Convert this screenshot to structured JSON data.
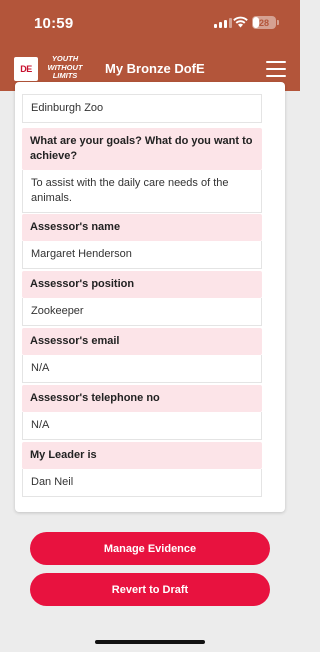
{
  "status_bar": {
    "time": "10:59",
    "battery_percent": "28",
    "battery_level": 0.28
  },
  "header": {
    "logo_text": "DE",
    "slogan": "Youth Without Limits",
    "title": "My Bronze DofE",
    "menu_icon": "hamburger-icon",
    "background_color": "#b3553a"
  },
  "details": {
    "location_value": "Edinburgh Zoo",
    "goals_label": "What are your goals? What do you want to achieve?",
    "goals_value": "To assist with the daily care needs of the animals.",
    "assessor_name_label": "Assessor's name",
    "assessor_name_value": "Margaret Henderson",
    "assessor_position_label": "Assessor's position",
    "assessor_position_value": "Zookeeper",
    "assessor_email_label": "Assessor's email",
    "assessor_email_value": "N/A",
    "assessor_phone_label": "Assessor's telephone no",
    "assessor_phone_value": "N/A",
    "leader_label": "My Leader is",
    "leader_value": "Dan Neil"
  },
  "actions": {
    "manage_evidence": "Manage Evidence",
    "revert_to_draft": "Revert to Draft",
    "button_color": "#e8123f"
  }
}
